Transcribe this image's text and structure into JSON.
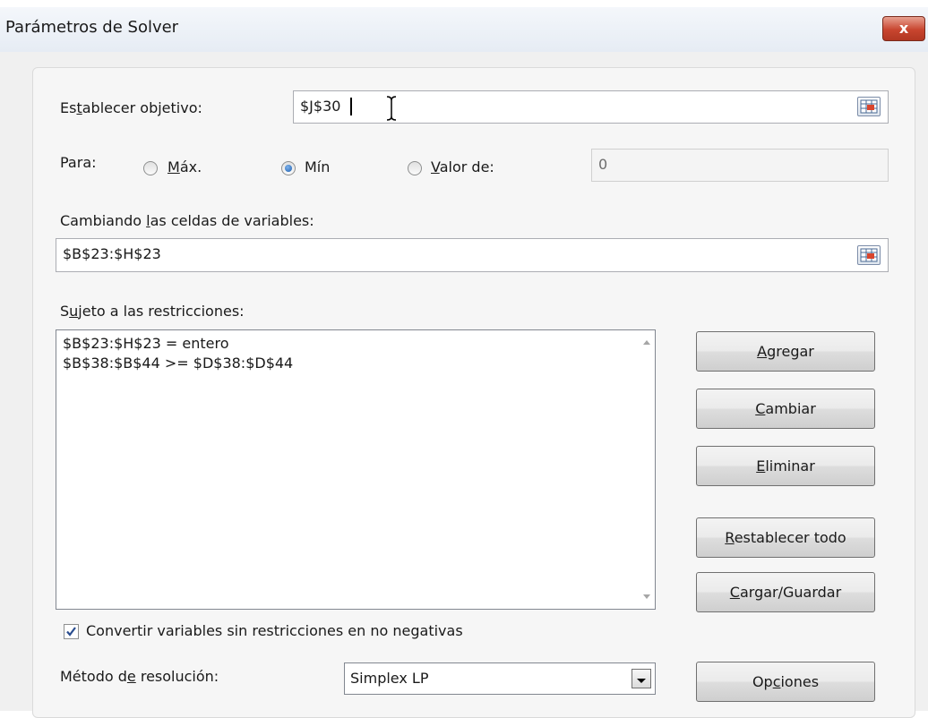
{
  "window": {
    "title": "Parámetros de Solver",
    "close_label": "x"
  },
  "objective": {
    "label_pre": "Es",
    "label_u": "t",
    "label_post": "ablecer objetivo:",
    "value": "$J$30"
  },
  "para": {
    "label": "Para:",
    "options": [
      {
        "pre": "",
        "u": "M",
        "post": "áx.",
        "selected": false
      },
      {
        "pre": "",
        "u": "",
        "post": "Mín",
        "selected": true
      },
      {
        "pre": "",
        "u": "V",
        "post": "alor de:",
        "selected": false
      }
    ],
    "valor_de_value": "0"
  },
  "variables": {
    "label_pre": "Cambiando ",
    "label_u": "l",
    "label_post": "as celdas de variables:",
    "value": "$B$23:$H$23"
  },
  "constraints": {
    "label_pre": "S",
    "label_u": "u",
    "label_post": "jeto a las restricciones:",
    "items": [
      "$B$23:$H$23 = entero",
      "$B$38:$B$44 >= $D$38:$D$44"
    ]
  },
  "buttons": {
    "agregar": {
      "u": "A",
      "post": "gregar"
    },
    "cambiar": {
      "u": "C",
      "post": "ambiar"
    },
    "eliminar": {
      "u": "E",
      "post": "liminar"
    },
    "restablecer": {
      "u": "R",
      "post": "establecer todo"
    },
    "cargar": {
      "u": "C",
      "post": "argar/Guardar"
    },
    "opciones": {
      "pre": "Op",
      "u": "c",
      "post": "iones"
    }
  },
  "nonnegative": {
    "label": "Convertir variables sin restricciones en no negativas",
    "checked": true
  },
  "method": {
    "label_pre": "Método d",
    "label_u": "e",
    "label_post": " resolución:",
    "value": "Simplex LP"
  },
  "colors": {
    "accent": "#1d5fb0",
    "close": "#c8452f"
  }
}
